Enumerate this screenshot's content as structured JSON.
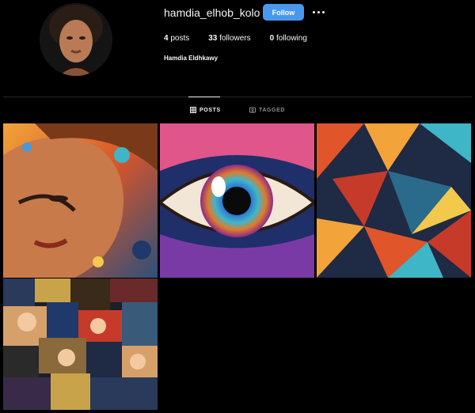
{
  "profile": {
    "username": "hamdia_elhob_kolo",
    "full_name": "Hamdia Eldhkawy",
    "follow_label": "Follow",
    "avatar_icon": "profile-photo"
  },
  "stats": {
    "posts_count": "4",
    "posts_label": "posts",
    "followers_count": "33",
    "followers_label": "followers",
    "following_count": "0",
    "following_label": "following"
  },
  "tabs": [
    {
      "label": "POSTS",
      "icon": "grid-icon",
      "active": true
    },
    {
      "label": "TAGGED",
      "icon": "tag-icon",
      "active": false
    }
  ],
  "posts": [
    {
      "subject": "colorful-portrait-art"
    },
    {
      "subject": "rainbow-eye-art"
    },
    {
      "subject": "geometric-abstract-art"
    },
    {
      "subject": "collage-art"
    }
  ],
  "colors": {
    "background": "#000000",
    "accent": "#4a98ee",
    "text": "#f5f5f5",
    "muted": "#8e8e8e",
    "divider": "#262626"
  }
}
